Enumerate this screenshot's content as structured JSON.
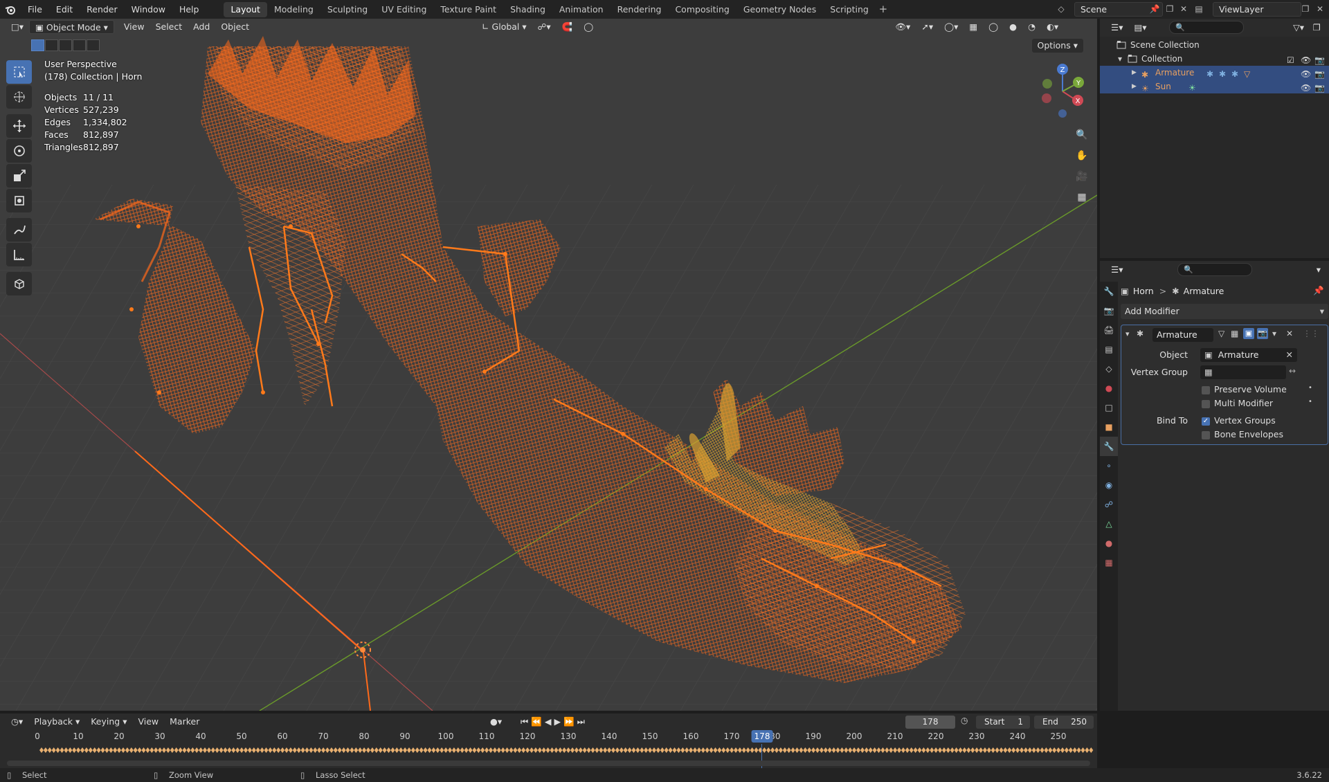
{
  "app": {
    "version": "3.6.22"
  },
  "topbar": {
    "menus": [
      "File",
      "Edit",
      "Render",
      "Window",
      "Help"
    ],
    "workspaces": [
      "Layout",
      "Modeling",
      "Sculpting",
      "UV Editing",
      "Texture Paint",
      "Shading",
      "Animation",
      "Rendering",
      "Compositing",
      "Geometry Nodes",
      "Scripting"
    ],
    "active_workspace": "Layout",
    "add_label": "+",
    "scene": "Scene",
    "view_layer": "ViewLayer"
  },
  "viewport": {
    "mode": "Object Mode",
    "menus": [
      "View",
      "Select",
      "Add",
      "Object"
    ],
    "transform_orientation": "Global",
    "options_label": "Options",
    "perspective_label": "User Perspective",
    "context_label": "(178) Collection | Horn",
    "stats": [
      {
        "label": "Objects",
        "value": "11 / 11"
      },
      {
        "label": "Vertices",
        "value": "527,239"
      },
      {
        "label": "Edges",
        "value": "1,334,802"
      },
      {
        "label": "Faces",
        "value": "812,897"
      },
      {
        "label": "Triangles",
        "value": "812,897"
      }
    ],
    "gizmo_axes": [
      "Z",
      "Y",
      "X"
    ],
    "tools": [
      "select-box-icon",
      "cursor-icon",
      "move-icon",
      "rotate-icon",
      "scale-icon",
      "transform-icon",
      "annotate-icon",
      "measure-icon",
      "add-cube-icon"
    ],
    "nav_icons": [
      "zoom-icon",
      "pan-hand-icon",
      "camera-icon",
      "grid-icon"
    ]
  },
  "outliner": {
    "root": "Scene Collection",
    "collection": "Collection",
    "items": [
      {
        "name": "Armature",
        "icon": "armature-icon",
        "color": "#e8a060"
      },
      {
        "name": "Sun",
        "icon": "light-icon",
        "color": "#e8a060"
      }
    ]
  },
  "properties": {
    "breadcrumb_object": "Horn",
    "breadcrumb_separator": ">",
    "breadcrumb_modifier": "Armature",
    "add_modifier_label": "Add Modifier",
    "modifier": {
      "name": "Armature",
      "object_label": "Object",
      "object_value": "Armature",
      "vertex_group_label": "Vertex Group",
      "vertex_group_value": "",
      "preserve_volume_label": "Preserve Volume",
      "preserve_volume": false,
      "multi_modifier_label": "Multi Modifier",
      "multi_modifier": false,
      "bind_to_label": "Bind To",
      "vertex_groups_label": "Vertex Groups",
      "vertex_groups": true,
      "bone_envelopes_label": "Bone Envelopes",
      "bone_envelopes": false
    }
  },
  "timeline": {
    "menus": [
      "Playback",
      "Keying",
      "View",
      "Marker"
    ],
    "current_frame": "178",
    "start_label": "Start",
    "start_value": "1",
    "end_label": "End",
    "end_value": "250",
    "ticks": [
      "0",
      "10",
      "20",
      "30",
      "40",
      "50",
      "60",
      "70",
      "80",
      "90",
      "100",
      "110",
      "120",
      "130",
      "140",
      "150",
      "160",
      "170",
      "180",
      "190",
      "200",
      "210",
      "220",
      "230",
      "240",
      "250"
    ]
  },
  "statusbar": {
    "items": [
      "Select",
      "Zoom View",
      "Lasso Select"
    ]
  },
  "colors": {
    "accent": "#4772b3",
    "selection_orange": "#ff6a1a",
    "active_yellow": "#d9a030",
    "viewport_bg": "#3d3d3d"
  }
}
